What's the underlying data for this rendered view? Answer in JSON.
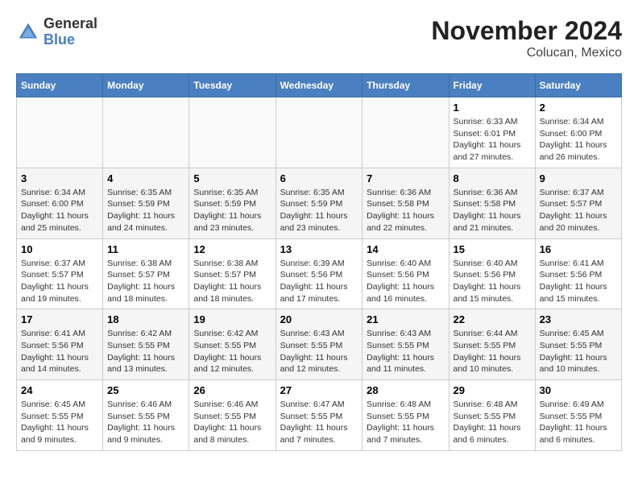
{
  "logo": {
    "general": "General",
    "blue": "Blue"
  },
  "title": "November 2024",
  "location": "Colucan, Mexico",
  "weekdays": [
    "Sunday",
    "Monday",
    "Tuesday",
    "Wednesday",
    "Thursday",
    "Friday",
    "Saturday"
  ],
  "weeks": [
    [
      {
        "day": "",
        "info": ""
      },
      {
        "day": "",
        "info": ""
      },
      {
        "day": "",
        "info": ""
      },
      {
        "day": "",
        "info": ""
      },
      {
        "day": "",
        "info": ""
      },
      {
        "day": "1",
        "info": "Sunrise: 6:33 AM\nSunset: 6:01 PM\nDaylight: 11 hours and 27 minutes."
      },
      {
        "day": "2",
        "info": "Sunrise: 6:34 AM\nSunset: 6:00 PM\nDaylight: 11 hours and 26 minutes."
      }
    ],
    [
      {
        "day": "3",
        "info": "Sunrise: 6:34 AM\nSunset: 6:00 PM\nDaylight: 11 hours and 25 minutes."
      },
      {
        "day": "4",
        "info": "Sunrise: 6:35 AM\nSunset: 5:59 PM\nDaylight: 11 hours and 24 minutes."
      },
      {
        "day": "5",
        "info": "Sunrise: 6:35 AM\nSunset: 5:59 PM\nDaylight: 11 hours and 23 minutes."
      },
      {
        "day": "6",
        "info": "Sunrise: 6:35 AM\nSunset: 5:59 PM\nDaylight: 11 hours and 23 minutes."
      },
      {
        "day": "7",
        "info": "Sunrise: 6:36 AM\nSunset: 5:58 PM\nDaylight: 11 hours and 22 minutes."
      },
      {
        "day": "8",
        "info": "Sunrise: 6:36 AM\nSunset: 5:58 PM\nDaylight: 11 hours and 21 minutes."
      },
      {
        "day": "9",
        "info": "Sunrise: 6:37 AM\nSunset: 5:57 PM\nDaylight: 11 hours and 20 minutes."
      }
    ],
    [
      {
        "day": "10",
        "info": "Sunrise: 6:37 AM\nSunset: 5:57 PM\nDaylight: 11 hours and 19 minutes."
      },
      {
        "day": "11",
        "info": "Sunrise: 6:38 AM\nSunset: 5:57 PM\nDaylight: 11 hours and 18 minutes."
      },
      {
        "day": "12",
        "info": "Sunrise: 6:38 AM\nSunset: 5:57 PM\nDaylight: 11 hours and 18 minutes."
      },
      {
        "day": "13",
        "info": "Sunrise: 6:39 AM\nSunset: 5:56 PM\nDaylight: 11 hours and 17 minutes."
      },
      {
        "day": "14",
        "info": "Sunrise: 6:40 AM\nSunset: 5:56 PM\nDaylight: 11 hours and 16 minutes."
      },
      {
        "day": "15",
        "info": "Sunrise: 6:40 AM\nSunset: 5:56 PM\nDaylight: 11 hours and 15 minutes."
      },
      {
        "day": "16",
        "info": "Sunrise: 6:41 AM\nSunset: 5:56 PM\nDaylight: 11 hours and 15 minutes."
      }
    ],
    [
      {
        "day": "17",
        "info": "Sunrise: 6:41 AM\nSunset: 5:56 PM\nDaylight: 11 hours and 14 minutes."
      },
      {
        "day": "18",
        "info": "Sunrise: 6:42 AM\nSunset: 5:55 PM\nDaylight: 11 hours and 13 minutes."
      },
      {
        "day": "19",
        "info": "Sunrise: 6:42 AM\nSunset: 5:55 PM\nDaylight: 11 hours and 12 minutes."
      },
      {
        "day": "20",
        "info": "Sunrise: 6:43 AM\nSunset: 5:55 PM\nDaylight: 11 hours and 12 minutes."
      },
      {
        "day": "21",
        "info": "Sunrise: 6:43 AM\nSunset: 5:55 PM\nDaylight: 11 hours and 11 minutes."
      },
      {
        "day": "22",
        "info": "Sunrise: 6:44 AM\nSunset: 5:55 PM\nDaylight: 11 hours and 10 minutes."
      },
      {
        "day": "23",
        "info": "Sunrise: 6:45 AM\nSunset: 5:55 PM\nDaylight: 11 hours and 10 minutes."
      }
    ],
    [
      {
        "day": "24",
        "info": "Sunrise: 6:45 AM\nSunset: 5:55 PM\nDaylight: 11 hours and 9 minutes."
      },
      {
        "day": "25",
        "info": "Sunrise: 6:46 AM\nSunset: 5:55 PM\nDaylight: 11 hours and 9 minutes."
      },
      {
        "day": "26",
        "info": "Sunrise: 6:46 AM\nSunset: 5:55 PM\nDaylight: 11 hours and 8 minutes."
      },
      {
        "day": "27",
        "info": "Sunrise: 6:47 AM\nSunset: 5:55 PM\nDaylight: 11 hours and 7 minutes."
      },
      {
        "day": "28",
        "info": "Sunrise: 6:48 AM\nSunset: 5:55 PM\nDaylight: 11 hours and 7 minutes."
      },
      {
        "day": "29",
        "info": "Sunrise: 6:48 AM\nSunset: 5:55 PM\nDaylight: 11 hours and 6 minutes."
      },
      {
        "day": "30",
        "info": "Sunrise: 6:49 AM\nSunset: 5:55 PM\nDaylight: 11 hours and 6 minutes."
      }
    ]
  ]
}
